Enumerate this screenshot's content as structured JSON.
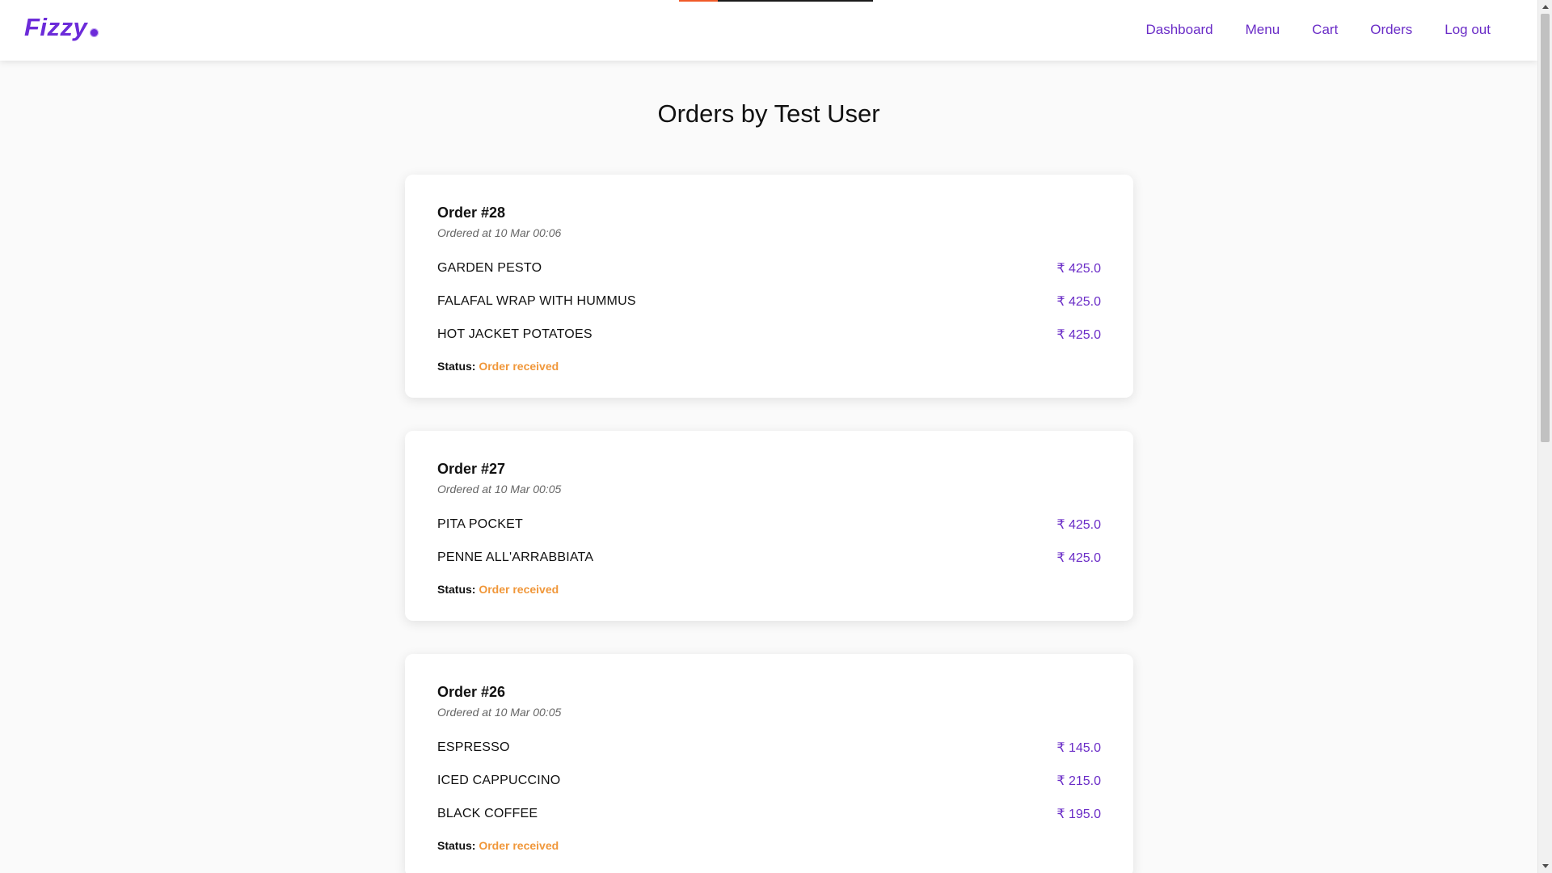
{
  "colors": {
    "brand": "#6c2bd9",
    "nav_link": "#6a2cc7",
    "price": "#6a2cc7",
    "status": "#f0973a",
    "progress_accent": "#f05a28"
  },
  "header": {
    "brand": "Fizzy",
    "nav": [
      {
        "label": "Dashboard"
      },
      {
        "label": "Menu"
      },
      {
        "label": "Cart"
      },
      {
        "label": "Orders"
      },
      {
        "label": "Log out"
      }
    ]
  },
  "page": {
    "title": "Orders by Test User"
  },
  "status_label": "Status:",
  "orders": [
    {
      "title": "Order #28",
      "time": "Ordered at 10 Mar 00:06",
      "items": [
        {
          "name": "GARDEN PESTO",
          "price": "₹ 425.0"
        },
        {
          "name": "FALAFAL WRAP WITH HUMMUS",
          "price": "₹ 425.0"
        },
        {
          "name": "HOT JACKET POTATOES",
          "price": "₹ 425.0"
        }
      ],
      "status": "Order received"
    },
    {
      "title": "Order #27",
      "time": "Ordered at 10 Mar 00:05",
      "items": [
        {
          "name": "PITA POCKET",
          "price": "₹ 425.0"
        },
        {
          "name": "PENNE ALL'ARRABBIATA",
          "price": "₹ 425.0"
        }
      ],
      "status": "Order received"
    },
    {
      "title": "Order #26",
      "time": "Ordered at 10 Mar 00:05",
      "items": [
        {
          "name": "ESPRESSO",
          "price": "₹ 145.0"
        },
        {
          "name": "ICED CAPPUCCINO",
          "price": "₹ 215.0"
        },
        {
          "name": "BLACK COFFEE",
          "price": "₹ 195.0"
        }
      ],
      "status": "Order received"
    }
  ]
}
